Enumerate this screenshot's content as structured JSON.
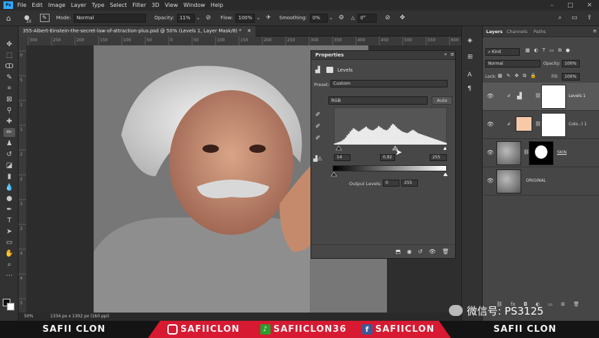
{
  "menu": {
    "items": [
      "File",
      "Edit",
      "Image",
      "Layer",
      "Type",
      "Select",
      "Filter",
      "3D",
      "View",
      "Window",
      "Help"
    ],
    "logo": "Ps"
  },
  "options": {
    "brush_size": "10",
    "mode_label": "Mode:",
    "mode_value": "Normal",
    "opacity_label": "Opacity:",
    "opacity_value": "11%",
    "flow_label": "Flow:",
    "flow_value": "100%",
    "smoothing_label": "Smoothing:",
    "smoothing_value": "0%",
    "angle_value": "0°"
  },
  "document": {
    "tab_title": "355-Albert-Einstein-the-secret-law-of-attraction-plus.psd @ 50% (Levels 1, Layer Mask/8) *",
    "zoom": "50%",
    "doc_info": "1334 px x 1302 px (150 ppi)"
  },
  "ruler": {
    "h_ticks": [
      "300",
      "250",
      "200",
      "150",
      "100",
      "50",
      "0",
      "50",
      "100",
      "150",
      "200",
      "250",
      "300",
      "350",
      "400",
      "450",
      "500",
      "550",
      "600"
    ],
    "v_ticks": [
      "0",
      "5",
      "1",
      "1",
      "2",
      "2",
      "3",
      "3",
      "4",
      "4",
      "5"
    ]
  },
  "properties": {
    "title": "Properties",
    "adjustment": "Levels",
    "preset_label": "Preset:",
    "preset_value": "Custom",
    "channel_value": "RGB",
    "auto_label": "Auto",
    "input_black": "14",
    "input_gamma": "0,92",
    "input_white": "255",
    "output_label": "Output Levels:",
    "output_black": "0",
    "output_white": "255",
    "histogram": [
      2,
      3,
      4,
      5,
      6,
      8,
      10,
      13,
      17,
      20,
      24,
      27,
      30,
      28,
      26,
      24,
      25,
      27,
      29,
      31,
      33,
      30,
      28,
      27,
      26,
      27,
      29,
      31,
      34,
      32,
      30,
      28,
      27,
      26,
      28,
      31,
      35,
      38,
      36,
      33,
      30,
      28,
      26,
      24,
      23,
      22,
      21,
      22,
      24,
      26,
      27,
      25,
      23,
      21,
      20,
      19,
      18,
      17,
      16,
      15,
      14,
      13,
      12,
      11,
      10,
      9,
      8,
      7,
      6,
      5,
      4,
      3
    ]
  },
  "layers_panel": {
    "tabs": [
      "Layers",
      "Channels",
      "Paths"
    ],
    "filter_value": "Kind",
    "blend_mode": "Normal",
    "opacity_label": "Opacity:",
    "opacity_value": "100%",
    "lock_label": "Lock:",
    "fill_label": "Fill:",
    "fill_value": "100%",
    "layers": [
      {
        "name": "Levels 1"
      },
      {
        "name": "Colo...l 1"
      },
      {
        "name": "SKIN"
      },
      {
        "name": "ORIGINAL"
      }
    ]
  },
  "banner": {
    "left_name": "SAFII CLON",
    "instagram": "SAFIICLON",
    "tiktok": "SAFIICLON36",
    "facebook": "SAFIICLON",
    "right_name": "SAFII CLON"
  },
  "watermark": "微信号: PS3125",
  "colors": {
    "accent": "#31a8ff",
    "banner_red": "#d71a32",
    "swatch": "#f6caa8"
  }
}
